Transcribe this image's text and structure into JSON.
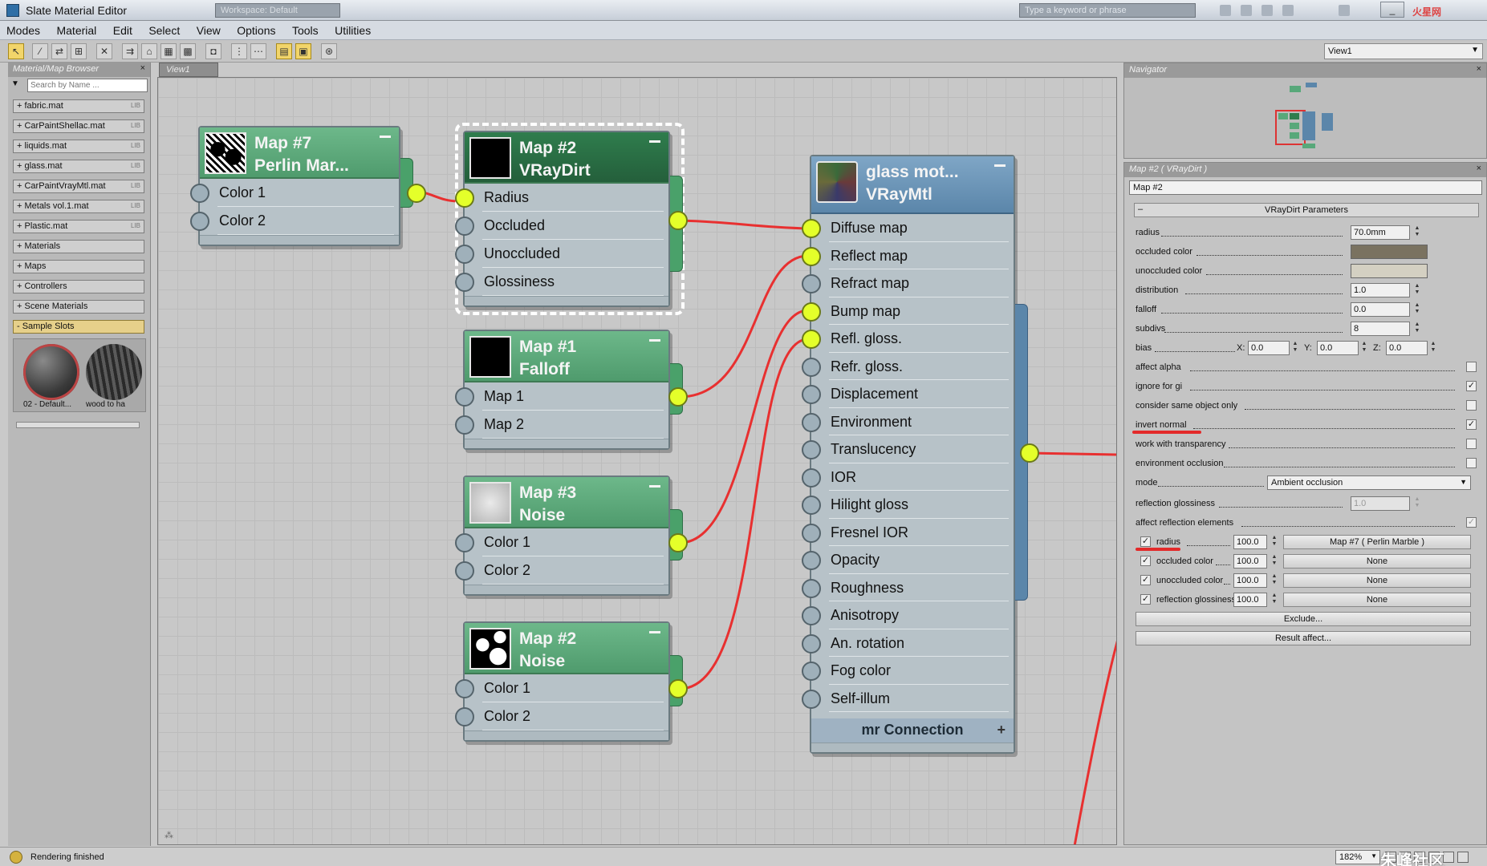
{
  "window": {
    "title": "Slate Material Editor",
    "workspace": "Workspace: Default",
    "search_placeholder": "Type a keyword or phrase",
    "brand": "火星网"
  },
  "menu": [
    "Modes",
    "Material",
    "Edit",
    "Select",
    "View",
    "Options",
    "Tools",
    "Utilities"
  ],
  "toolbar": {
    "view_select": "View1"
  },
  "browser": {
    "title": "Material/Map Browser",
    "search_placeholder": "Search by Name ...",
    "libraries": [
      {
        "label": "+ fabric.mat",
        "tag": "LIB"
      },
      {
        "label": "+ CarPaintShellac.mat",
        "tag": "LIB"
      },
      {
        "label": "+ liquids.mat",
        "tag": "LIB"
      },
      {
        "label": "+ glass.mat",
        "tag": "LIB"
      },
      {
        "label": "+ CarPaintVrayMtl.mat",
        "tag": "LIB"
      },
      {
        "label": "+ Metals vol.1.mat",
        "tag": "LIB"
      },
      {
        "label": "+ Plastic.mat",
        "tag": "LIB"
      },
      {
        "label": "+ Materials",
        "tag": ""
      },
      {
        "label": "+ Maps",
        "tag": ""
      },
      {
        "label": "+ Controllers",
        "tag": ""
      },
      {
        "label": "+ Scene Materials",
        "tag": ""
      },
      {
        "label": "- Sample Slots",
        "tag": ""
      }
    ],
    "sample_slots": [
      "02 - Default...",
      "wood to ha"
    ]
  },
  "view": {
    "tab": "View1"
  },
  "nodes": {
    "perlin": {
      "name1": "Map #7",
      "name2": "Perlin Mar...",
      "slots": [
        "Color 1",
        "Color 2"
      ]
    },
    "vraydirt": {
      "name1": "Map #2",
      "name2": "VRayDirt",
      "slots": [
        "Radius",
        "Occluded",
        "Unoccluded",
        "Glossiness"
      ]
    },
    "falloff": {
      "name1": "Map #1",
      "name2": "Falloff",
      "slots": [
        "Map 1",
        "Map 2"
      ]
    },
    "noise3": {
      "name1": "Map #3",
      "name2": "Noise",
      "slots": [
        "Color 1",
        "Color 2"
      ]
    },
    "noise2": {
      "name1": "Map #2",
      "name2": "Noise",
      "slots": [
        "Color 1",
        "Color 2"
      ]
    },
    "glass": {
      "name1": "glass  mot...",
      "name2": "VRayMtl",
      "slots": [
        "Diffuse map",
        "Reflect map",
        "Refract map",
        "Bump map",
        "Refl. gloss.",
        "Refr. gloss.",
        "Displacement",
        "Environment",
        "Translucency",
        "IOR",
        "Hilight gloss",
        "Fresnel IOR",
        "Opacity",
        "Roughness",
        "Anisotropy",
        "An. rotation",
        "Fog color",
        "Self-illum"
      ],
      "connection": "mr Connection"
    }
  },
  "navigator": {
    "title": "Navigator"
  },
  "params": {
    "title": "Map #2  ( VRayDirt )",
    "map_name": "Map #2",
    "rollout": "VRayDirt Parameters",
    "radius_label": "radius",
    "radius_value": "70.0mm",
    "occluded_color_label": "occluded color",
    "occluded_color": "#7a7260",
    "unoccluded_color_label": "unoccluded color",
    "unoccluded_color": "#d4d0c2",
    "distribution_label": "distribution",
    "distribution_value": "1.0",
    "falloff_label": "falloff",
    "falloff_value": "0.0",
    "subdivs_label": "subdivs",
    "subdivs_value": "8",
    "bias_label": "bias",
    "bias_x_label": "X:",
    "bias_x": "0.0",
    "bias_y_label": "Y:",
    "bias_y": "0.0",
    "bias_z_label": "Z:",
    "bias_z": "0.0",
    "affect_alpha": "affect alpha",
    "ignore_for_gi": "ignore for gi",
    "consider_same_object": "consider same object only",
    "invert_normal": "invert normal",
    "work_with_transparency": "work with transparency",
    "environment_occlusion": "environment occlusion",
    "mode_label": "mode",
    "mode_value": "Ambient occlusion",
    "reflection_glossiness_label": "reflection glossiness",
    "reflection_glossiness_value": "1.0",
    "affect_reflection_elements": "affect reflection elements",
    "check": "✓",
    "map_rows": [
      {
        "label": "radius",
        "value": "100.0",
        "map": "Map #7  ( Perlin Marble )"
      },
      {
        "label": "occluded color",
        "value": "100.0",
        "map": "None"
      },
      {
        "label": "unoccluded color",
        "value": "100.0",
        "map": "None"
      },
      {
        "label": "reflection glossiness",
        "value": "100.0",
        "map": "None"
      }
    ],
    "exclude_button": "Exclude...",
    "result_affect_button": "Result affect..."
  },
  "status": {
    "text": "Rendering finished",
    "zoom": "182%",
    "watermark": "朱峰社区"
  }
}
